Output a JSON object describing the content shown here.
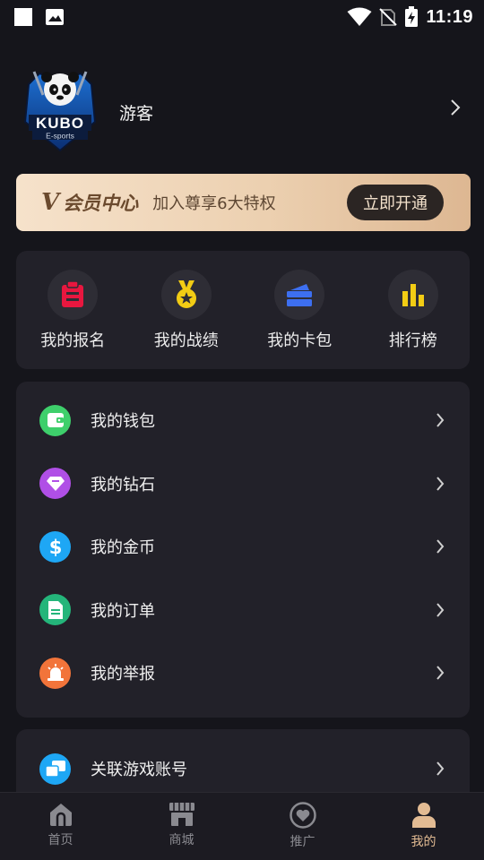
{
  "status_bar": {
    "time": "11:19",
    "icons": [
      "square-notification-icon",
      "image-notification-icon",
      "wifi-icon",
      "no-sim-icon",
      "battery-charging-icon"
    ]
  },
  "profile": {
    "avatar_logo_text": "KUBO E-sports",
    "username": "游客"
  },
  "vip": {
    "logo_v": "V",
    "logo_title": "会员中心",
    "description": "加入尊享6大特权",
    "button_label": "立即开通",
    "colors": {
      "gradient_start": "#f6e2cb",
      "gradient_end": "#ddb792",
      "button_bg": "#2b2523"
    }
  },
  "quick_actions": [
    {
      "label": "我的报名",
      "icon": "clipboard-icon",
      "color": "#e8173f"
    },
    {
      "label": "我的战绩",
      "icon": "medal-icon",
      "color": "#f2cc14"
    },
    {
      "label": "我的卡包",
      "icon": "card-wallet-icon",
      "color": "#3d6ff0"
    },
    {
      "label": "排行榜",
      "icon": "bar-chart-icon",
      "color": "#f2cc14"
    }
  ],
  "menu": [
    {
      "label": "我的钱包",
      "icon": "wallet-icon",
      "color": "#3ecf6b"
    },
    {
      "label": "我的钻石",
      "icon": "diamond-icon",
      "color": "#b04fe6"
    },
    {
      "label": "我的金币",
      "icon": "dollar-coin-icon",
      "color": "#1ea7f5"
    },
    {
      "label": "我的订单",
      "icon": "order-document-icon",
      "color": "#24b57a"
    },
    {
      "label": "我的举报",
      "icon": "alarm-siren-icon",
      "color": "#f2743a"
    }
  ],
  "menu2": [
    {
      "label": "关联游戏账号",
      "icon": "linked-accounts-icon",
      "color": "#1ea7f5"
    }
  ],
  "bottom_nav": {
    "items": [
      {
        "label": "首页",
        "icon": "home-icon"
      },
      {
        "label": "商城",
        "icon": "store-icon"
      },
      {
        "label": "推广",
        "icon": "heart-promote-icon"
      },
      {
        "label": "我的",
        "icon": "profile-person-icon",
        "active": true
      }
    ],
    "active_color": "#e2bb93",
    "inactive_color": "#8a8a90"
  }
}
